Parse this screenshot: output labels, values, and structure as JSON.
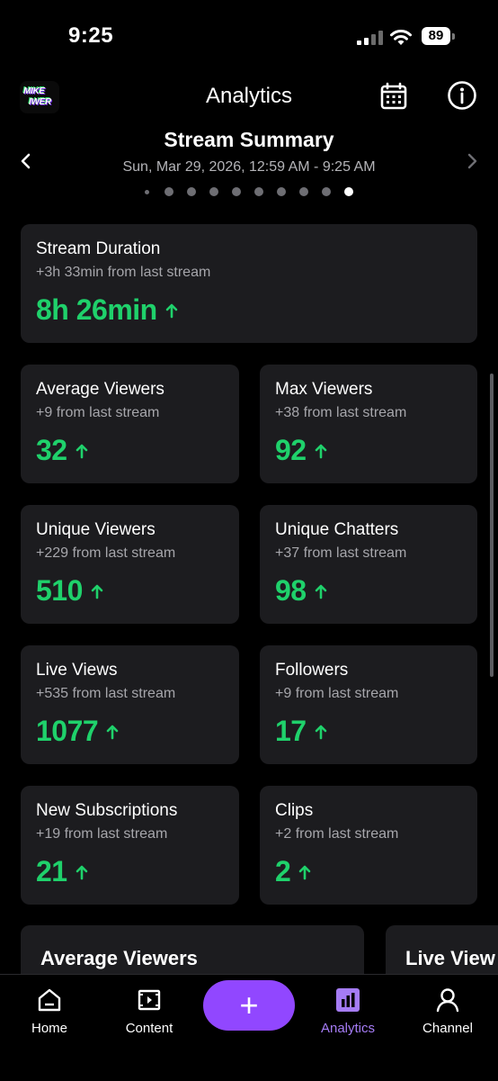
{
  "status_bar": {
    "time": "9:25",
    "battery": "89"
  },
  "header": {
    "avatar_text_line1": "MIKE",
    "avatar_text_line2": "IWER",
    "title": "Analytics",
    "calendar_icon": "calendar-icon",
    "info_icon": "info-icon"
  },
  "summary": {
    "title": "Stream Summary",
    "date_range": "Sun, Mar 29, 2026, 12:59 AM - 9:25 AM",
    "pages_total": 10,
    "active_page": 10
  },
  "stats": {
    "stream_duration": {
      "label": "Stream Duration",
      "delta": "+3h 33min from last stream",
      "value": "8h 26min"
    },
    "average_viewers": {
      "label": "Average Viewers",
      "delta": "+9 from last stream",
      "value": "32"
    },
    "max_viewers": {
      "label": "Max Viewers",
      "delta": "+38 from last stream",
      "value": "92"
    },
    "unique_viewers": {
      "label": "Unique Viewers",
      "delta": "+229 from last stream",
      "value": "510"
    },
    "unique_chatters": {
      "label": "Unique Chatters",
      "delta": "+37 from last stream",
      "value": "98"
    },
    "live_views": {
      "label": "Live Views",
      "delta": "+535 from last stream",
      "value": "1077"
    },
    "followers": {
      "label": "Followers",
      "delta": "+9 from last stream",
      "value": "17"
    },
    "new_subscriptions": {
      "label": "New Subscriptions",
      "delta": "+19 from last stream",
      "value": "21"
    },
    "clips": {
      "label": "Clips",
      "delta": "+2 from last stream",
      "value": "2"
    }
  },
  "charts_preview": {
    "first_title": "Average Viewers",
    "second_title": "Live View"
  },
  "tabbar": {
    "home": "Home",
    "content": "Content",
    "create": "+",
    "analytics": "Analytics",
    "channel": "Channel"
  },
  "colors": {
    "background": "#000000",
    "card": "#1c1c1f",
    "positive": "#1fd16b",
    "accent": "#9147ff",
    "active_tab": "#a57cf5"
  }
}
